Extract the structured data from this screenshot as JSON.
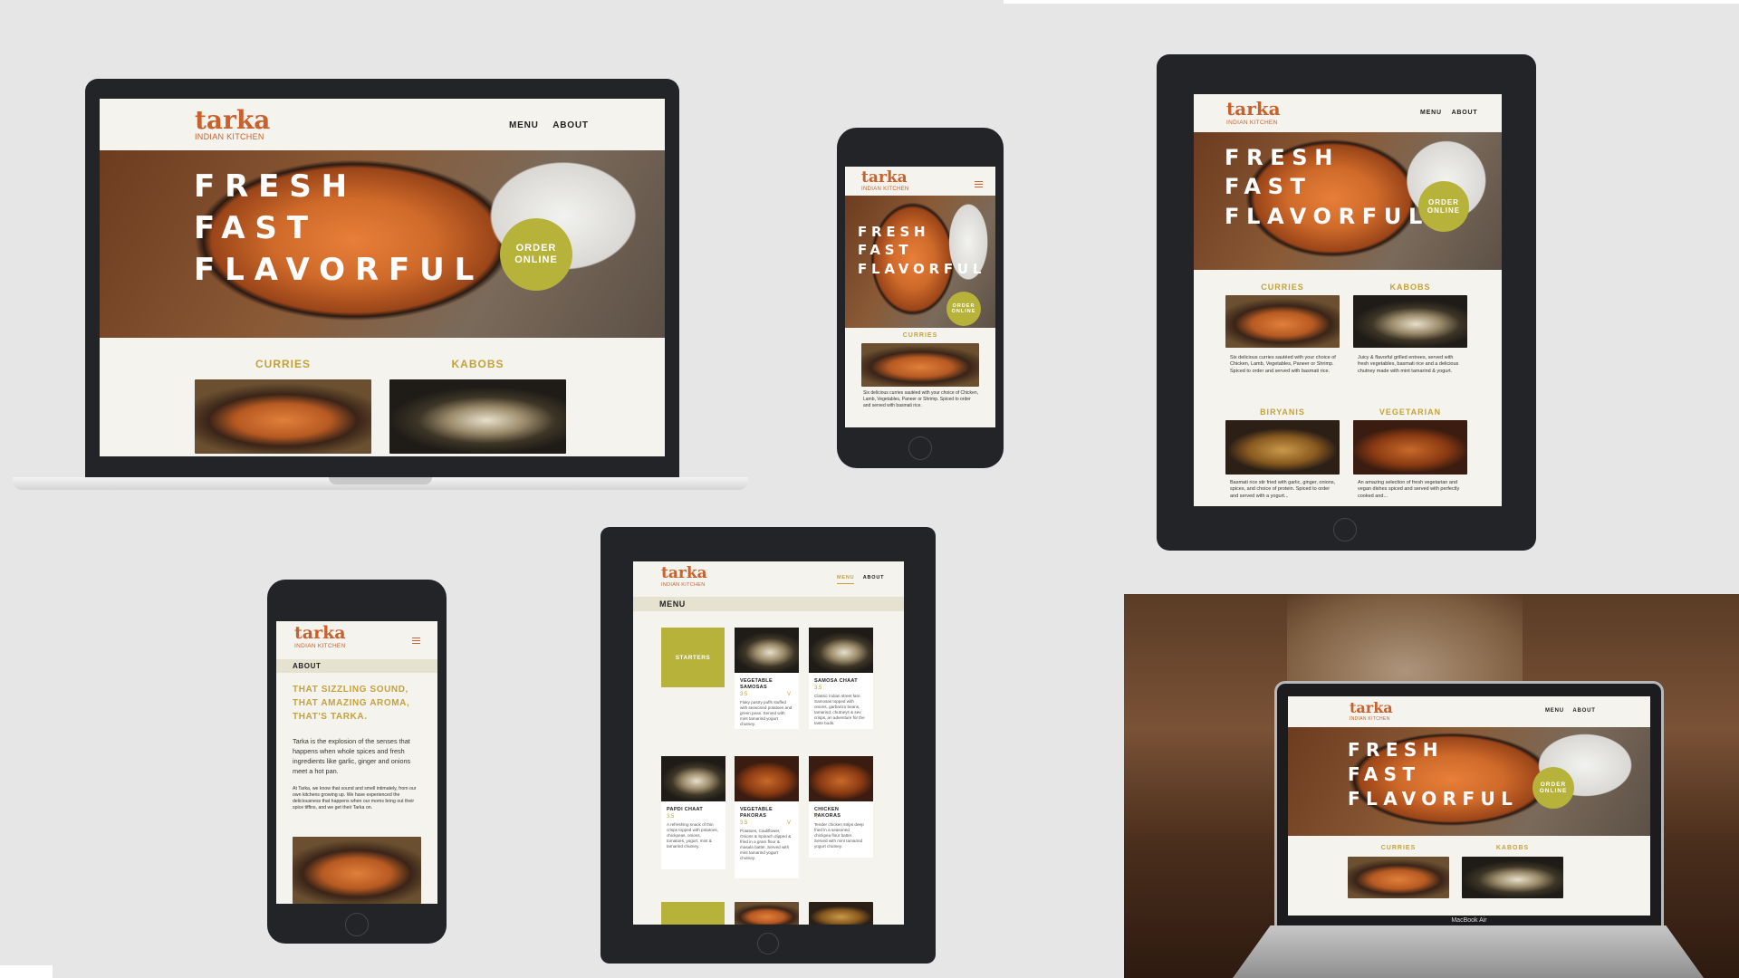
{
  "brand": {
    "name": "tarka",
    "subtitle": "INDIAN KITCHEN",
    "accent": "#c8612c",
    "olive": "#b7b23a",
    "gold": "#c4a23a"
  },
  "nav": {
    "menu": "MENU",
    "about": "ABOUT"
  },
  "hero": {
    "line1": "FRESH",
    "line2": "FAST",
    "line3": "FLAVORFUL",
    "order_line1": "ORDER",
    "order_line2": "ONLINE"
  },
  "sections": {
    "curries": "CURRIES",
    "kabobs": "KABOBS",
    "biryanis": "BIRYANIS",
    "vegetarian": "VEGETARIAN"
  },
  "descriptions": {
    "curries": "Six delicious curries sautéed with your choice of Chicken, Lamb, Vegetables, Paneer or Shrimp. Spiced to order and served with basmati rice.",
    "kabobs": "Juicy & flavorful grilled entrees, served with fresh vegetables, basmati rice and a delicious chutney made with mint tamarind & yogurt.",
    "biryanis": "Basmati rice stir fried with garlic, ginger, onions, spices, and choice of protein. Spiced to order and served with a yogurt...",
    "vegetarian": "An amazing selection of fresh vegetarian and vegan dishes spiced and served with perfectly cooked and..."
  },
  "menu_page": {
    "title": "MENU",
    "starters": "STARTERS",
    "items": [
      {
        "name": "VEGETABLE SAMOSAS",
        "price": "3.5",
        "flag": "V",
        "text": "Flaky pastry puffs stuffed with seasoned potatoes and green peas. Served with mint tamarind yogurt chutney."
      },
      {
        "name": "SAMOSA CHAAT",
        "price": "3.5",
        "flag": "",
        "text": "Classic Indian street fare. Samosas topped with onions, garbanzo beans, tamarind, chutneys & sev crisps, an adventure for the taste buds."
      },
      {
        "name": "PAPDI CHAAT",
        "price": "3.5",
        "flag": "",
        "text": "A refreshing snack of thin crisps topped with potatoes, chickpeas, onions, tomatoes, yogurt, mint & tamarind chutney."
      },
      {
        "name": "VEGETABLE PAKORAS",
        "price": "3.5",
        "flag": "V",
        "text": "Potatoes, Cauliflower, Onions & Spinach dipped & fried in a gram flour & masala batter. Served with mint tamarind yogurt chutney."
      },
      {
        "name": "CHICKEN PAKORAS",
        "price": "4",
        "flag": "",
        "text": "Tender chicken strips deep fried in a seasoned chickpea flour batter. Served with mint tamarind yogurt chutney."
      }
    ]
  },
  "about_page": {
    "heading": "ABOUT",
    "tagline1": "THAT SIZZLING SOUND,",
    "tagline2": "THAT AMAZING AROMA,",
    "tagline3": "THAT'S TARKA.",
    "para1": "Tarka is the explosion of the senses that happens when whole spices and fresh ingredients like garlic, ginger and onions meet a hot pan.",
    "para2": "At Tarka, we know that sound and smell intimately, from our own kitchens growing up. We have experienced the deliciousness that happens when our moms bring out their spice tiffins, and we get their Tarka on."
  },
  "laptop_label": "MacBook Air"
}
